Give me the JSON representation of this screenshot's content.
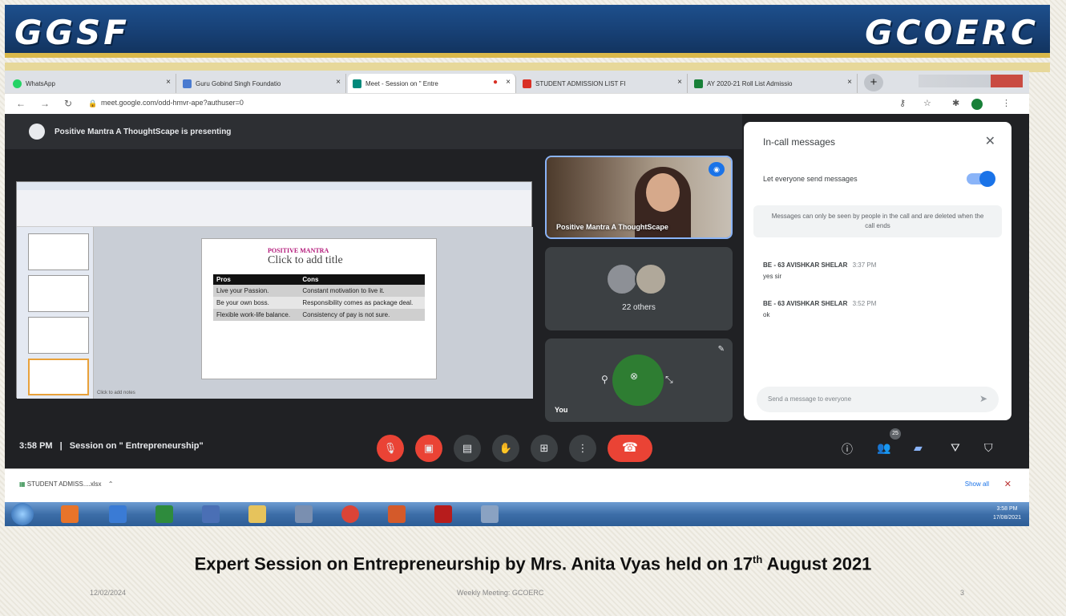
{
  "banner": {
    "left_brand": "GGSF",
    "right_brand": "GCOERC"
  },
  "browser": {
    "tabs": [
      {
        "label": "WhatsApp",
        "color": "#25d366"
      },
      {
        "label": "Guru Gobind Singh Foundatio",
        "color": "#4a7bd0"
      },
      {
        "label": "Meet - Session on \" Entre",
        "color": "#00897b",
        "active": true
      },
      {
        "label": "STUDENT ADMISSION LIST FI",
        "color": "#d93025"
      },
      {
        "label": "AY 2020-21 Roll List Admissio",
        "color": "#188038"
      }
    ],
    "url": "meet.google.com/odd-hmvr-ape?authuser=0",
    "new_tab": "+"
  },
  "meet": {
    "presenting_text": "Positive Mantra A ThoughtScape is presenting",
    "slide": {
      "title_brand": "POSITIVE MANTRA",
      "title_placeholder": "Click to add title",
      "headers": [
        "Pros",
        "Cons"
      ],
      "rows": [
        [
          "Live your Passion.",
          "Constant motivation to live it."
        ],
        [
          "Be your own boss.",
          "Responsibility comes as package deal."
        ],
        [
          "Flexible work-life balance.",
          "Consistency of pay is not sure."
        ]
      ],
      "notes_placeholder": "Click to add notes"
    },
    "tiles": {
      "presenter_name": "Positive Mantra A ThoughtScape",
      "others": "22 others",
      "you": "You"
    },
    "chat": {
      "title": "In-call messages",
      "toggle_label": "Let everyone send messages",
      "notice": "Messages can only be seen by people in the call and are deleted when the call ends",
      "messages": [
        {
          "name": "BE - 63 AVISHKAR SHELAR",
          "time": "3:37 PM",
          "text": "yes sir"
        },
        {
          "name": "BE - 63 AVISHKAR SHELAR",
          "time": "3:52 PM",
          "text": "ok"
        }
      ],
      "input_placeholder": "Send a message to everyone"
    },
    "meeting_time": "3:58 PM",
    "meeting_separator": "|",
    "meeting_title": "Session on \" Entrepreneurship\"",
    "people_count": "25"
  },
  "downloads": {
    "item": "STUDENT ADMISS....xlsx",
    "show_all": "Show all"
  },
  "taskbar": {
    "time": "3:58 PM",
    "date": "17/08/2021"
  },
  "caption": {
    "main": "Expert Session on Entrepreneurship by Mrs. Anita Vyas held on 17",
    "sup": "th",
    "end": " August 2021"
  },
  "footer": {
    "date": "12/02/2024",
    "center": "Weekly Meeting: GCOERC",
    "page": "3"
  }
}
